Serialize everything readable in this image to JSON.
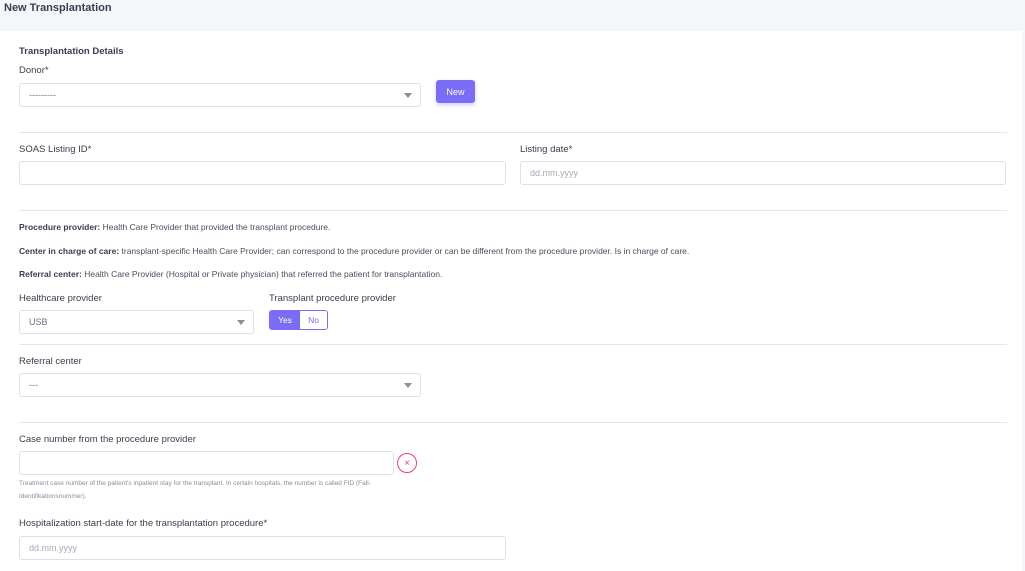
{
  "page": {
    "title": "New Transplantation"
  },
  "details": {
    "section_title": "Transplantation Details",
    "donor_label": "Donor*",
    "donor_value": "---------",
    "new_button": "New"
  },
  "listing": {
    "soas_label": "SOAS Listing ID*",
    "soas_value": "",
    "date_label": "Listing date*",
    "date_placeholder": "dd.mm.yyyy"
  },
  "info": {
    "procedure_provider_term": "Procedure provider:",
    "procedure_provider_text": " Health Care Provider that provided the transplant procedure.",
    "center_term": "Center in charge of care:",
    "center_text": " transplant-specific Health Care Provider; can correspond to the procedure provider or can be different from the procedure provider. Is in charge of care.",
    "referral_term": "Referral center:",
    "referral_text": " Health Care Provider (Hospital or Private physician) that referred the patient for transplantation."
  },
  "provider": {
    "healthcare_label": "Healthcare provider",
    "healthcare_value": "USB",
    "procedure_label": "Transplant procedure provider",
    "yes_label": "Yes",
    "no_label": "No",
    "selected": "Yes"
  },
  "referral": {
    "label": "Referral center",
    "value": "---"
  },
  "case": {
    "label": "Case number from the procedure provider",
    "value": "",
    "clear_icon": "×",
    "help_text": "Treatment case number of the patient's inpatient stay for the transplant. In certain hospitals, the number is called FID (Fall-Identifikationsnummer)."
  },
  "hospitalization": {
    "label": "Hospitalization start-date for the transplantation procedure*",
    "placeholder": "dd.mm.yyyy"
  },
  "colors": {
    "accent": "#7b6cf6",
    "danger": "#f1416c",
    "border": "#dfe1e8"
  }
}
